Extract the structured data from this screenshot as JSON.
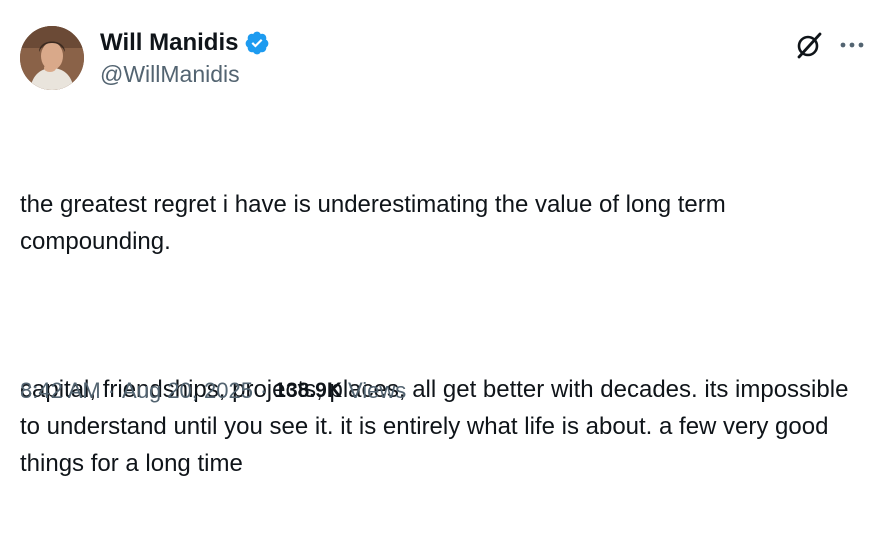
{
  "author": {
    "display_name": "Will Manidis",
    "handle": "@WillManidis",
    "verified_badge_color": "#1d9bf0"
  },
  "icons": {
    "avatar": "profile-photo",
    "verified": "verified-badge-icon",
    "grok": "grok-icon",
    "more": "more-options-icon"
  },
  "tweet": {
    "paragraphs": [
      "the greatest regret i have is underestimating the value of long term compounding.",
      "capital, friendships, projects, places, all get better with decades. its impossible to understand until you see it. it is entirely what life is about. a few very good things for a long time"
    ]
  },
  "meta": {
    "time": "8:42 AM",
    "separator": "·",
    "date": "Aug 20, 2025",
    "views_count": "138.9K",
    "views_label": "Views"
  },
  "colors": {
    "text_primary": "#0f1419",
    "text_secondary": "#536471",
    "accent": "#1d9bf0"
  }
}
